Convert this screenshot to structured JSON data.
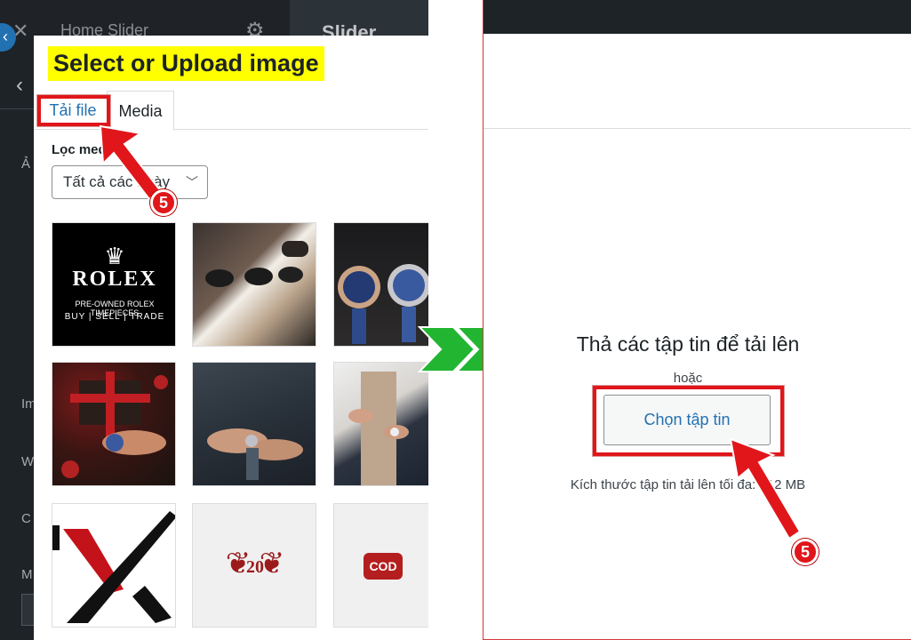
{
  "left_panel": {
    "background_header_title": "Home Slider",
    "background_header_tab": "Slider",
    "background_letters": [
      "Ả",
      "Im",
      "W",
      "C",
      "M"
    ],
    "modal": {
      "title": "Select or Upload image",
      "tabs": [
        {
          "label": "Tải file",
          "active": false
        },
        {
          "label": "Media",
          "active": true
        }
      ],
      "filter_label": "Lọc media",
      "date_filter_value": "Tất cả các ngày",
      "thumbnails": [
        {
          "subject": "rolex-logo",
          "brand_text": "ROLEX",
          "line1": "PRE-OWNED ROLEX TIMEPIECES",
          "line2": "BUY | SELL | TRADE"
        },
        {
          "subject": "sunglasses-models"
        },
        {
          "subject": "luxury-watches"
        },
        {
          "subject": "watch-gift-christmas"
        },
        {
          "subject": "man-denim-jacket-watch"
        },
        {
          "subject": "man-coat-watch"
        },
        {
          "subject": "x-logo"
        },
        {
          "subject": "anniversary-emblem",
          "number": "20"
        },
        {
          "subject": "cod-badge",
          "badge_text": "COD"
        }
      ]
    }
  },
  "right_panel": {
    "drop_title": "Thả các tập tin để tải lên",
    "or_text": "hoặc",
    "select_button_label": "Chọn tập tin",
    "max_size_text": "Kích thước tập tin tải lên tối đa: 512 MB"
  },
  "annotations": {
    "step_number": "5",
    "highlight_color": "#e0161b",
    "arrow_color": "#22b532"
  },
  "colors": {
    "wp_blue": "#2271b1",
    "admin_dark": "#1d2327",
    "title_highlight": "#ffff00"
  }
}
